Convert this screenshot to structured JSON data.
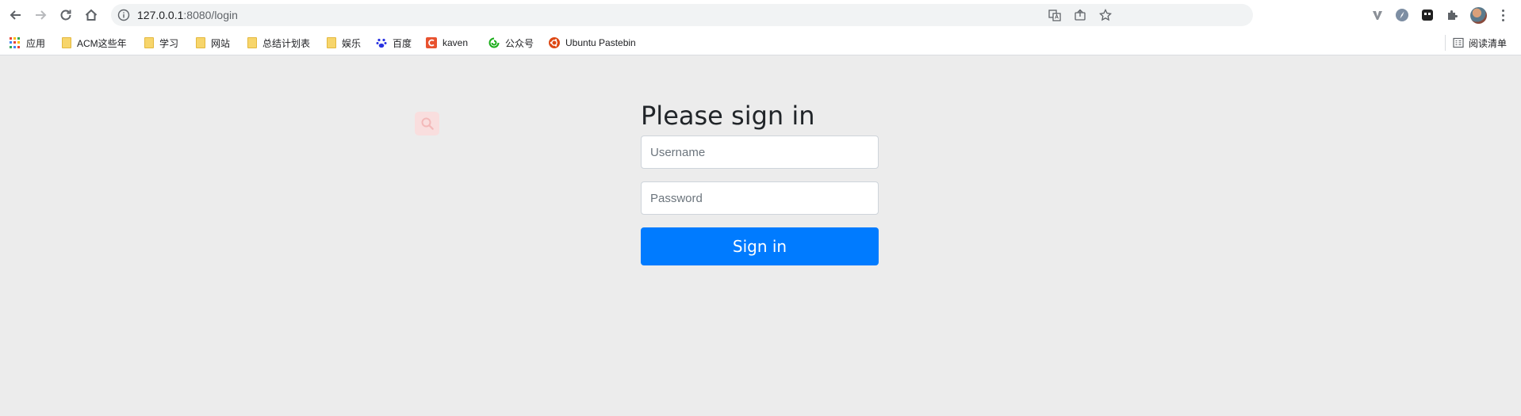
{
  "browser": {
    "url_host": "127.0.0.1",
    "url_rest": ":8080/login"
  },
  "bookmarks": [
    {
      "label": "应用",
      "icon": "apps-grid-icon"
    },
    {
      "label": "ACM这些年",
      "icon": "folder-icon"
    },
    {
      "label": "学习",
      "icon": "folder-icon"
    },
    {
      "label": "网站",
      "icon": "folder-icon"
    },
    {
      "label": "总结计划表",
      "icon": "folder-icon"
    },
    {
      "label": "娱乐",
      "icon": "folder-icon"
    },
    {
      "label": "百度",
      "icon": "baidu-paw-icon"
    },
    {
      "label": "kaven",
      "icon": "csdn-c-icon"
    },
    {
      "label": "公众号",
      "icon": "wechat-icon"
    },
    {
      "label": "Ubuntu Pastebin",
      "icon": "ubuntu-icon"
    }
  ],
  "reading_list": {
    "label": "阅读清单"
  },
  "login": {
    "title": "Please sign in",
    "username_placeholder": "Username",
    "password_placeholder": "Password",
    "submit_label": "Sign in"
  },
  "colors": {
    "page_background": "#ececec",
    "primary_button": "#007bff"
  }
}
